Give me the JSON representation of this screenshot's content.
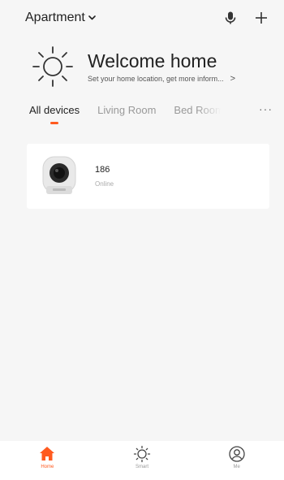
{
  "header": {
    "home_name": "Apartment",
    "icons": {
      "dropdown": "chevron-down-icon",
      "voice": "microphone-icon",
      "add": "plus-icon"
    }
  },
  "welcome": {
    "title": "Welcome home",
    "subtitle": "Set your home location, get more inform...",
    "chevron": ">",
    "icon": "sun-icon"
  },
  "tabs": [
    {
      "label": "All devices",
      "active": true
    },
    {
      "label": "Living Room",
      "active": false
    },
    {
      "label": "Bed Room",
      "active": false
    }
  ],
  "tabs_more": "···",
  "devices": [
    {
      "name": "186",
      "status": "Online",
      "icon": "camera-icon"
    }
  ],
  "bottom_nav": [
    {
      "label": "Home",
      "icon": "home-icon",
      "active": true
    },
    {
      "label": "Smart",
      "icon": "sun-outline-icon",
      "active": false
    },
    {
      "label": "Me",
      "icon": "user-circle-icon",
      "active": false
    }
  ],
  "colors": {
    "accent": "#ff5a1f",
    "background": "#f6f6f6",
    "card": "#ffffff",
    "muted_text": "#999999"
  }
}
